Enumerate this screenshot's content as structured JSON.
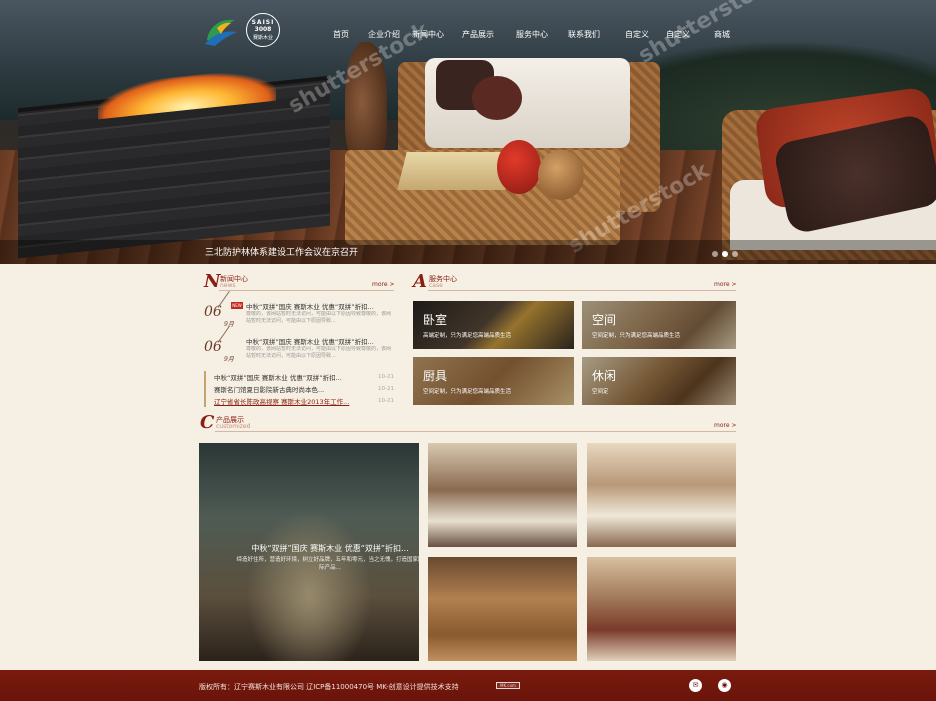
{
  "brand": {
    "badge_line1": "SAISI",
    "badge_line2": "3008",
    "badge_line3": "赛斯木业"
  },
  "nav": [
    "首页",
    "企业介绍",
    "新闻中心",
    "产品展示",
    "服务中心",
    "联系我们",
    "自定义",
    "自定义",
    "商城"
  ],
  "hero": {
    "caption": "三北防护林体系建设工作会议在京召开",
    "watermark": "shutterstock",
    "slides": 3,
    "active_slide": 1
  },
  "news": {
    "letter": "N",
    "title": "新闻中心",
    "subtitle": "news",
    "more": "more >",
    "hot_label": "NEW",
    "features": [
      {
        "day": "06",
        "month": "9月",
        "title": "中秋“双拼”国庆 赛斯木业 优惠“双拼”折扣...",
        "desc": "尊敬的，该网站暂时无法访问，可能由以下原因导致尊敬的，该网站暂时无法访问，可能由以下原因导致..."
      },
      {
        "day": "06",
        "month": "9月",
        "title": "中秋“双拼”国庆 赛斯木业 优惠“双拼”折扣...",
        "desc": "尊敬的，该网站暂时无法访问，可能由以下原因导致尊敬的，该网站暂时无法访问，可能由以下原因导致..."
      }
    ],
    "list": [
      {
        "title": "中秋“双拼”国庆 赛斯木业 优惠“双拼”折扣...",
        "date": "10-21"
      },
      {
        "title": "赛斯名门馆夏日影院新古典时尚本色...",
        "date": "10-21"
      },
      {
        "title": "辽宁省省长陈政高视察 赛斯木业2013年工作...",
        "date": "10-21"
      }
    ]
  },
  "service": {
    "letter": "A",
    "title": "服务中心",
    "subtitle": "case",
    "more": "more >",
    "items": [
      {
        "title": "卧室",
        "desc": "高端定制，只为满足您高端品质生活"
      },
      {
        "title": "空间",
        "desc": "空间定制，只为满足您高端品质生活"
      },
      {
        "title": "厨具",
        "desc": "空间定制，只为满足您高端品质生活"
      },
      {
        "title": "休闲",
        "desc": "空间定"
      }
    ]
  },
  "products": {
    "letter": "C",
    "title": "产品展示",
    "subtitle": "customized",
    "more": "more >",
    "main_title": "中秋“双拼”国庆 赛斯木业 优惠“双拼”折扣...",
    "main_desc": "缔造好住所，营造好环境，树立好品牌，五年和零元，当之无愧，打造国家国际产品..."
  },
  "footer": {
    "copyright": "版权所有：辽宁赛斯木业有限公司      辽ICP备11000470号      MK-创意设计提供技术支持",
    "badge": "MK.com",
    "social": [
      "wechat-icon",
      "weibo-icon"
    ]
  },
  "colors": {
    "accent": "#8a1e12",
    "footer": "#6a140a",
    "background": "#f6efe3",
    "gold": "#c6a270"
  }
}
